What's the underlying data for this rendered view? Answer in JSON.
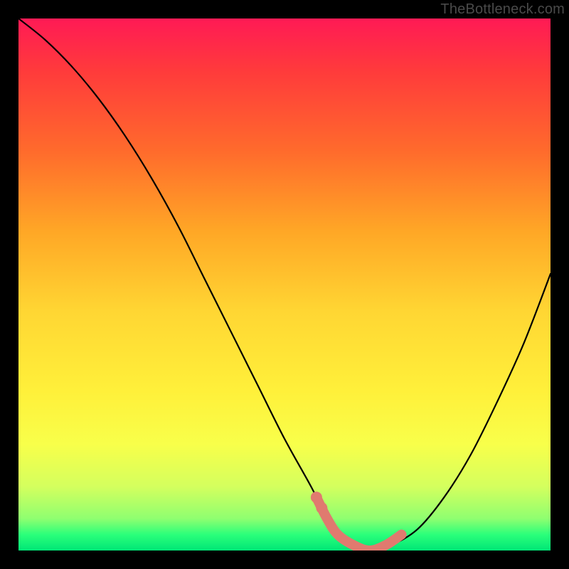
{
  "watermark": "TheBottleneck.com",
  "chart_data": {
    "type": "line",
    "title": "",
    "xlabel": "",
    "ylabel": "",
    "x_range": [
      0,
      100
    ],
    "y_range": [
      0,
      100
    ],
    "series": [
      {
        "name": "bottleneck-curve",
        "x": [
          0,
          5,
          10,
          15,
          20,
          25,
          30,
          35,
          40,
          45,
          50,
          55,
          58,
          60,
          63,
          66,
          70,
          75,
          80,
          85,
          90,
          95,
          100
        ],
        "y": [
          100,
          96,
          91,
          85,
          78,
          70,
          61,
          51,
          41,
          31,
          21,
          12,
          6,
          3,
          1,
          0,
          1,
          4,
          10,
          18,
          28,
          39,
          52
        ]
      }
    ],
    "highlight_segment": {
      "name": "optimal-range",
      "x": [
        56,
        58,
        60,
        63,
        66,
        69,
        72
      ],
      "y": [
        10,
        6,
        3,
        1,
        0,
        1,
        3
      ]
    },
    "colors": {
      "curve": "#000000",
      "highlight": "#e07a6f",
      "gradient_top": "#ff1a55",
      "gradient_bottom": "#00e676",
      "frame": "#000000"
    }
  }
}
